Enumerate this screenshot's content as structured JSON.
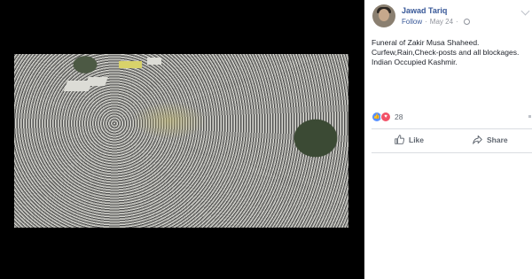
{
  "post": {
    "author": "Jawad Tariq",
    "follow_label": "Follow",
    "separator": "·",
    "date": "May 24",
    "separator2": "·",
    "privacy_icon": "globe-icon",
    "lines": [
      "Funeral of Zakir Musa Shaheed.",
      "Curfew,Rain,Check-posts and all blockages.",
      "Indian Occupied Kashmir."
    ],
    "reaction_icons": [
      "like-icon",
      "love-icon"
    ],
    "reaction_count": "28"
  },
  "actions": {
    "like_label": "Like",
    "share_label": "Share"
  },
  "colors": {
    "link_blue": "#385898",
    "viewer_bg": "#000000",
    "like_blue": "#5890ff",
    "love_red": "#f25268"
  }
}
